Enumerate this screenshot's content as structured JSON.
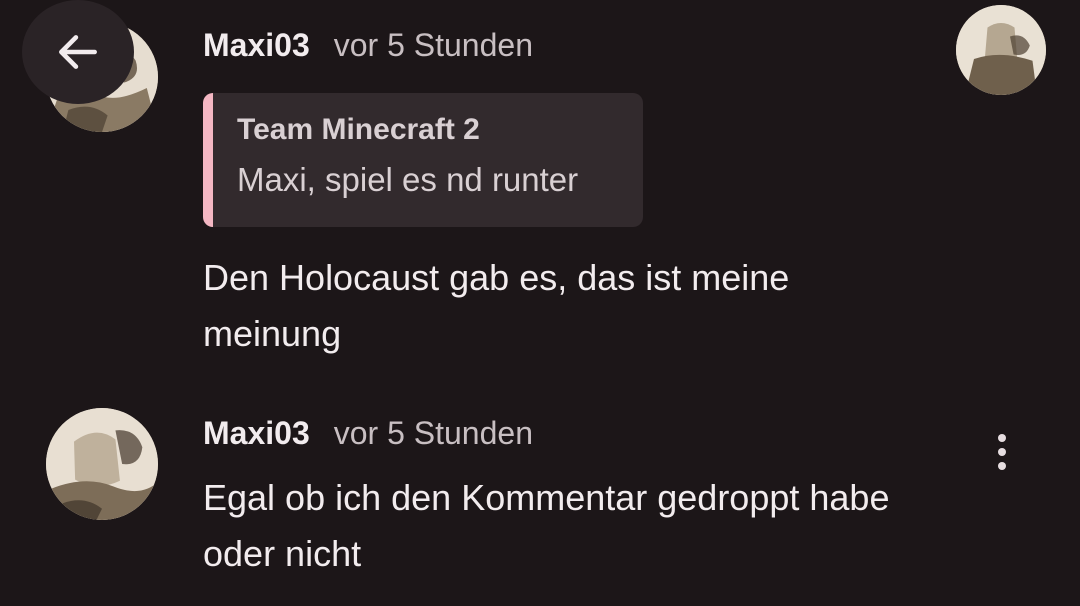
{
  "comments": [
    {
      "author": "Maxi03",
      "time": "vor 5 Stunden",
      "quote": {
        "author": "Team Minecraft 2",
        "text": "Maxi, spiel es nd runter"
      },
      "body_line1": "Den Holocaust gab es, das ist meine",
      "body_line2": "meinung"
    },
    {
      "author": "Maxi03",
      "time": "vor 5 Stunden",
      "body_line1": "Egal ob ich den Kommentar gedroppt habe",
      "body_line2": "oder nicht"
    }
  ],
  "icons": {
    "back": "arrow-left-icon",
    "more": "more-vertical-icon"
  },
  "colors": {
    "background": "#1c1618",
    "quote_accent": "#f4b7c3",
    "quote_background": "#322a2d"
  }
}
